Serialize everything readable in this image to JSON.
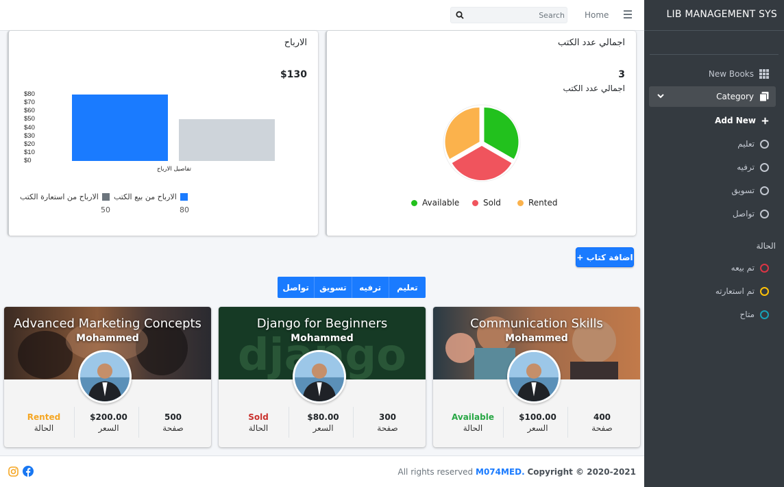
{
  "topnav": {
    "search_placeholder": "Search",
    "home_label": "Home"
  },
  "profit_card": {
    "title": "الارباح",
    "total": "$130",
    "legend": [
      {
        "label": "الارباح من بيع الكتب",
        "color": "#1a7bff",
        "value": "80"
      },
      {
        "label": "الارباح من استعارة الكتب",
        "color": "#6c757d",
        "value": "50"
      }
    ]
  },
  "chart_data": {
    "type": "bar",
    "categories": [
      "تفاصيل الارباح"
    ],
    "series": [
      {
        "name": "الارباح من بيع الكتب",
        "values": [
          80
        ],
        "color": "#1a7bff"
      },
      {
        "name": "الارباح من استعارة الكتب",
        "values": [
          50
        ],
        "color": "#ced4da"
      }
    ],
    "yticks": [
      "$80",
      "$70",
      "$60",
      "$50",
      "$40",
      "$30",
      "$20",
      "$10",
      "$0"
    ],
    "ylim": [
      0,
      80
    ],
    "xlabel": "تفاصيل الارباح"
  },
  "books_card": {
    "title": "اجمالي عدد الكتب",
    "total": "3",
    "subtitle": "اجمالي عدد الكتب",
    "pie": [
      {
        "label": "Available",
        "value": 1,
        "color": "#22c11d"
      },
      {
        "label": "Sold",
        "value": 1,
        "color": "#f0545d"
      },
      {
        "label": "Rented",
        "value": 1,
        "color": "#fbb24c"
      }
    ]
  },
  "add_book_label": "+ اضافة كتاب",
  "category_tabs": [
    "تعليم",
    "ترفيه",
    "تسويق",
    "تواصل"
  ],
  "books": [
    {
      "title": "Advanced Marketing Concepts",
      "author": "Mohammed",
      "status": "Rented",
      "status_color": "#f5a623",
      "status_label": "الحالة",
      "price": "$200.00",
      "price_label": "السعر",
      "pages": "500",
      "pages_label": "صفحة"
    },
    {
      "title": "Django for Beginners",
      "author": "Mohammed",
      "status": "Sold",
      "status_color": "#c9302c",
      "status_label": "الحالة",
      "price": "$80.00",
      "price_label": "السعر",
      "pages": "300",
      "pages_label": "صفحة"
    },
    {
      "title": "Communication Skills",
      "author": "Mohammed",
      "status": "Available",
      "status_color": "#28a745",
      "status_label": "الحالة",
      "price": "$100.00",
      "price_label": "السعر",
      "pages": "400",
      "pages_label": "صفحة"
    }
  ],
  "footer": {
    "copyright_prefix": "Copyright © 2020-2021",
    "brand": "M074MED.",
    "rights": "All rights reserved",
    "social_icons": [
      "instagram-icon",
      "facebook-icon"
    ]
  },
  "sidebar": {
    "brand": "LIB MANAGEMENT SYS",
    "new_books": "New Books",
    "category": "Category",
    "add_new": "Add New",
    "categories": [
      "تعليم",
      "ترفيه",
      "تسويق",
      "تواصل"
    ],
    "status_header": "الحالة",
    "statuses": [
      {
        "label": "تم بيعه",
        "color": "#dc3545"
      },
      {
        "label": "تم استعارته",
        "color": "#ffc107"
      },
      {
        "label": "متاح",
        "color": "#17a2b8"
      }
    ]
  }
}
